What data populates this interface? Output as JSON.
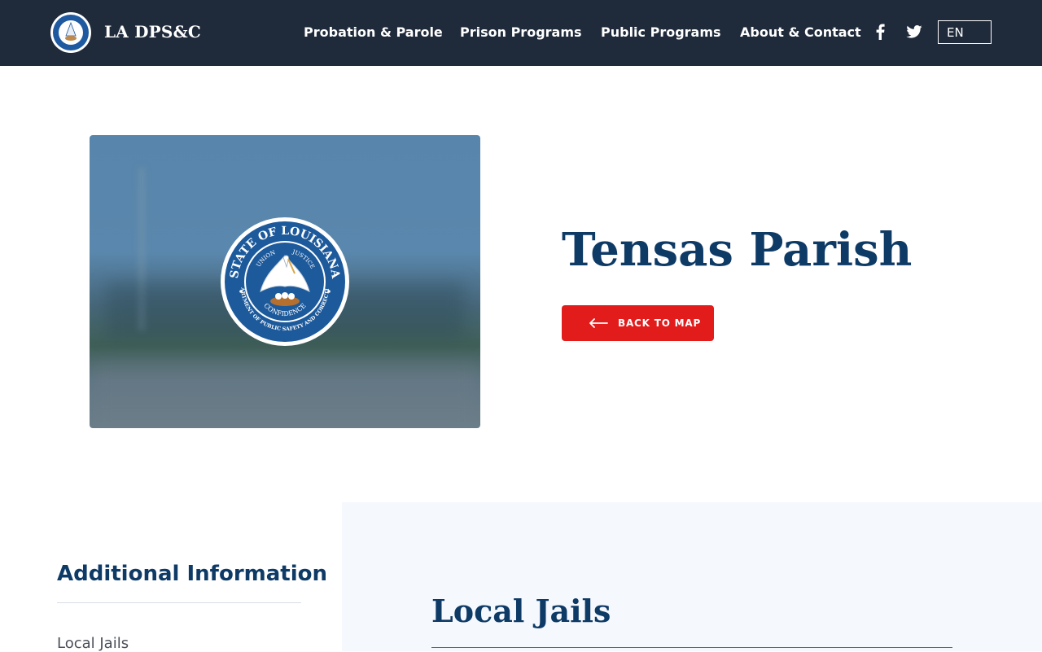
{
  "header": {
    "brand": "LA DPS&C",
    "nav": [
      {
        "label": "Probation & Parole"
      },
      {
        "label": "Prison Programs"
      },
      {
        "label": "Public Programs"
      },
      {
        "label": "About & Contact"
      }
    ],
    "social": [
      "facebook-icon",
      "twitter-icon"
    ],
    "language": "EN"
  },
  "hero": {
    "image_alt": "State of Louisiana Department of Public Safety and Corrections seal",
    "seal_text": {
      "top": "STATE OF LOUISIANA",
      "inner_left": "UNION",
      "inner_right": "JUSTICE",
      "inner_bottom": "CONFIDENCE",
      "bottom": "DEPARTMENT OF PUBLIC SAFETY AND CORRECTIONS"
    },
    "title": "Tensas Parish",
    "back_button": "BACK TO MAP"
  },
  "sidebar": {
    "title": "Additional Information",
    "links": [
      {
        "label": "Local Jails"
      }
    ]
  },
  "content": {
    "section_title": "Local Jails"
  },
  "colors": {
    "navbar": "#1f2a3a",
    "accent_red": "#e21b1b",
    "heading_blue": "#0e3a66",
    "panel_bg": "#f5f8fc"
  }
}
